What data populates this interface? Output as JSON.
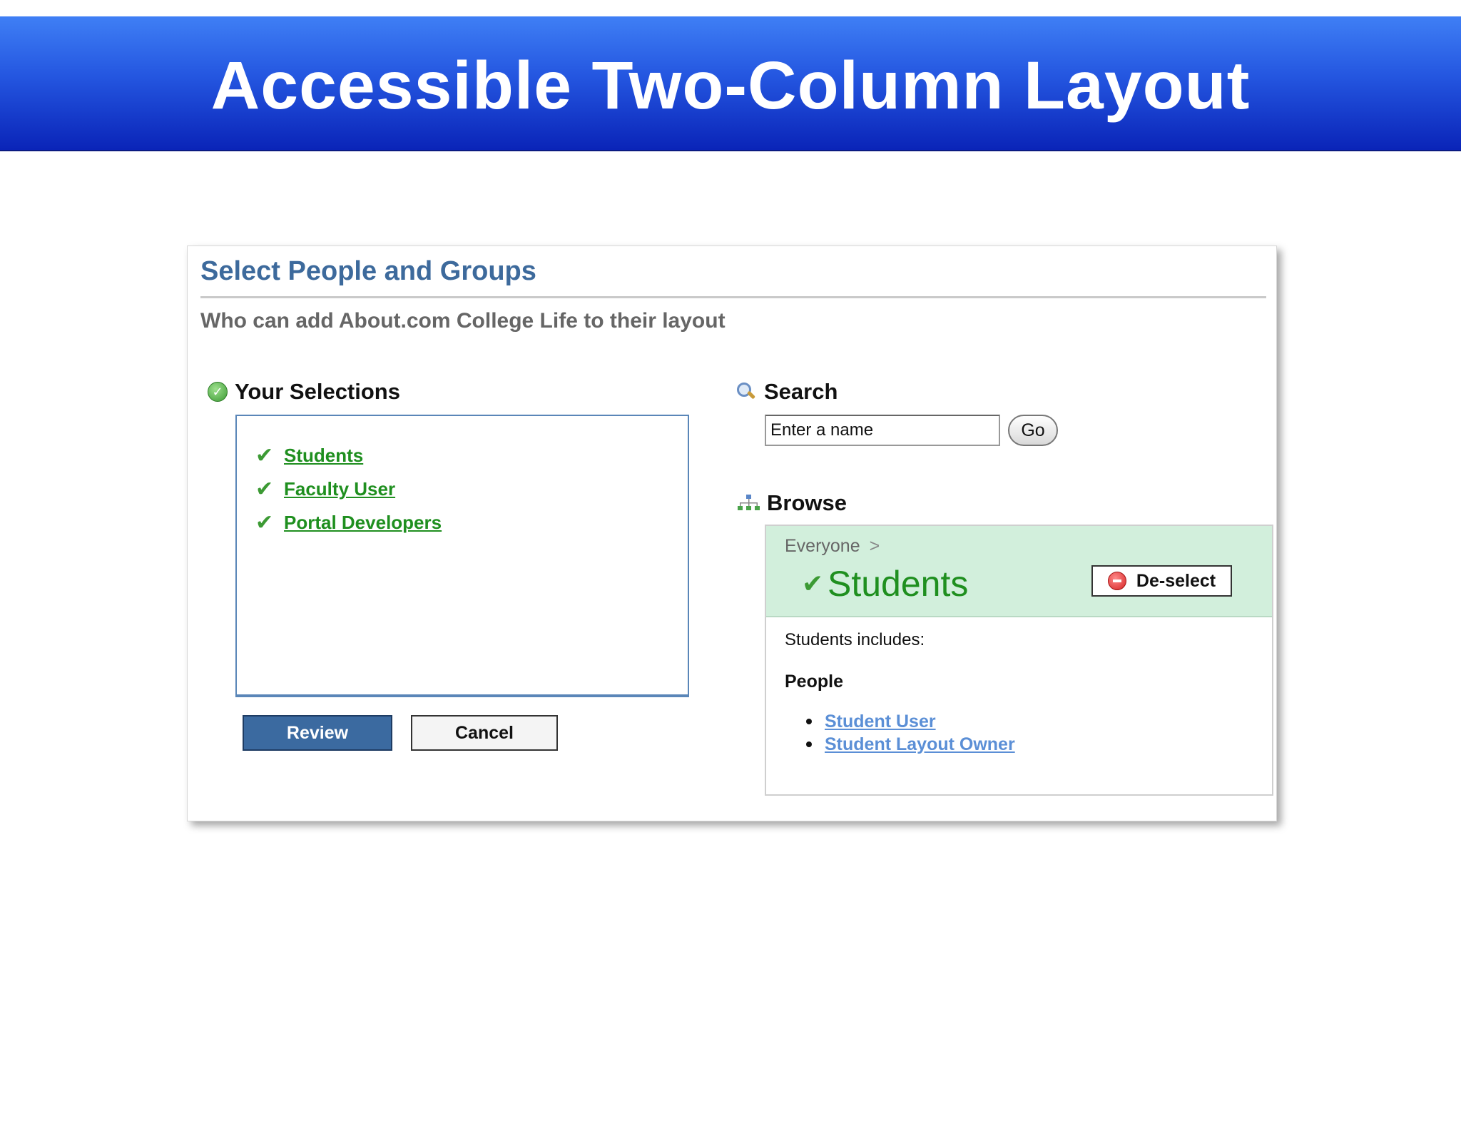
{
  "slide": {
    "title": "Accessible Two-Column Layout"
  },
  "panel": {
    "title": "Select People and Groups",
    "subtitle": "Who can add About.com College Life to their layout"
  },
  "selections": {
    "heading": "Your Selections",
    "items": [
      {
        "label": "Students"
      },
      {
        "label": "Faculty User"
      },
      {
        "label": "Portal Developers"
      }
    ],
    "review_label": "Review",
    "cancel_label": "Cancel"
  },
  "search": {
    "heading": "Search",
    "placeholder": "Enter a name",
    "go_label": "Go"
  },
  "browse": {
    "heading": "Browse",
    "breadcrumb": "Everyone",
    "breadcrumb_separator": ">",
    "group_name": "Students",
    "deselect_label": "De-select",
    "includes_text": "Students includes:",
    "people_heading": "People",
    "people": [
      {
        "label": "Student User"
      },
      {
        "label": "Student Layout Owner"
      }
    ]
  },
  "colors": {
    "banner_top": "#3f7ff5",
    "banner_bottom": "#0a24b8",
    "panel_title": "#3d6a9c",
    "selection_link": "#1f8f1f",
    "people_link": "#5b8fd6",
    "browse_header_bg": "#d2efdc",
    "review_button": "#3b6aa0"
  },
  "icons": {
    "selections": "check-circle-icon",
    "selection_item": "checkmark-icon",
    "search": "magnifier-icon",
    "browse": "org-tree-icon",
    "deselect": "minus-circle-icon"
  }
}
